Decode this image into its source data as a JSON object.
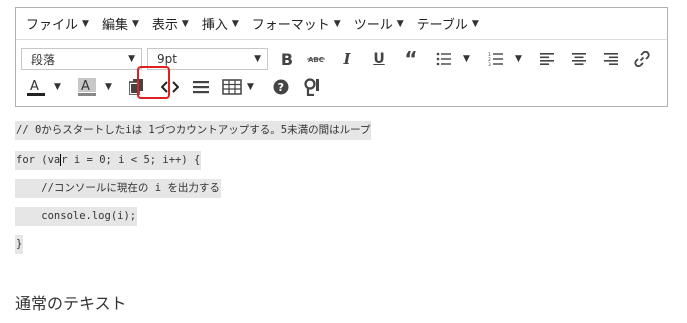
{
  "menubar": {
    "items": [
      {
        "label": "ファイル"
      },
      {
        "label": "編集"
      },
      {
        "label": "表示"
      },
      {
        "label": "挿入"
      },
      {
        "label": "フォーマット"
      },
      {
        "label": "ツール"
      },
      {
        "label": "テーブル"
      }
    ]
  },
  "toolbar": {
    "format_select": "段落",
    "fontsize_select": "9pt",
    "icons": [
      "bold-icon",
      "strikethrough-icon",
      "italic-icon",
      "underline-icon",
      "blockquote-icon",
      "bullet-list-icon",
      "numbered-list-icon",
      "align-left-icon",
      "align-center-icon",
      "align-right-icon",
      "link-icon",
      "text-color-icon",
      "background-color-icon",
      "paste-icon",
      "code-icon",
      "horizontal-rule-icon",
      "table-icon",
      "help-icon",
      "special-chars-icon"
    ],
    "highlight_color": "#e02020"
  },
  "content": {
    "code_lines": [
      "// 0からスタートしたiは 1づつカウントアップする。5未満の間はループ",
      "for (va",
      "r i = 0; i < 5; i++) {",
      "    //コンソールに現在の i を出力する",
      "    console.log(i);",
      "}"
    ],
    "normal_text": "通常のテキスト"
  }
}
